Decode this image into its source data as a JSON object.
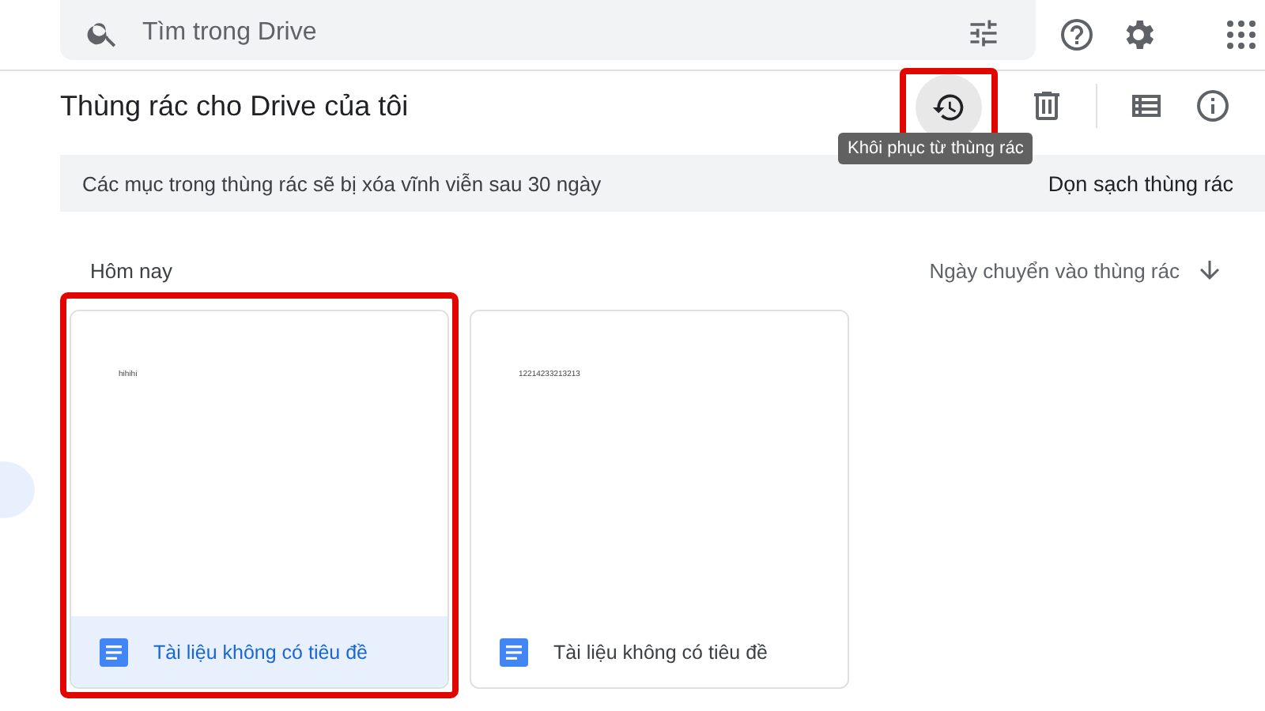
{
  "search": {
    "placeholder": "Tìm trong Drive"
  },
  "page_title": "Thùng rác cho Drive của tôi",
  "toolbar": {
    "restore": {
      "hovered": true,
      "annotated": true,
      "tooltip": "Khôi phục từ thùng rác"
    }
  },
  "banner": {
    "message": "Các mục trong thùng rác sẽ bị xóa vĩnh viễn sau 30 ngày",
    "action": "Dọn sạch thùng rác"
  },
  "section": {
    "label": "Hôm nay",
    "sort_label": "Ngày chuyển vào thùng rác"
  },
  "files": [
    {
      "name": "Tài liệu không có tiêu đề",
      "preview": "hihihi",
      "selected": true,
      "annotated": true
    },
    {
      "name": "Tài liệu không có tiêu đề",
      "preview": "12214233213213",
      "selected": false,
      "annotated": false
    }
  ]
}
